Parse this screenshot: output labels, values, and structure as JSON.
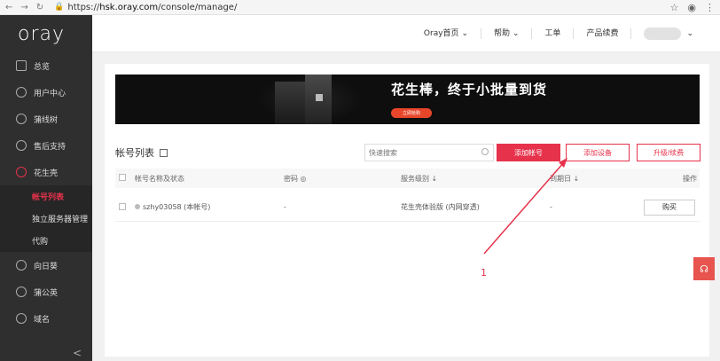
{
  "browser": {
    "url_prefix": "https://",
    "url_host": "hsk.oray.com",
    "url_path": "/console/manage/"
  },
  "sidebar": {
    "logo": "oray",
    "items": [
      {
        "label": "总览"
      },
      {
        "label": "用户中心"
      },
      {
        "label": "蒲线树"
      },
      {
        "label": "售后支持"
      },
      {
        "label": "花生壳"
      }
    ],
    "submenu": [
      {
        "label": "帐号列表"
      },
      {
        "label": "独立服务器管理"
      },
      {
        "label": "代购"
      }
    ],
    "items_bottom": [
      {
        "label": "向日葵"
      },
      {
        "label": "蒲公英"
      },
      {
        "label": "域名"
      }
    ],
    "collapse": "<"
  },
  "topbar": {
    "home": "Oray首页",
    "help": "帮助",
    "ticket": "工单",
    "renew": "产品续费"
  },
  "banner": {
    "headline": "花生棒，终于小批量到货",
    "cta": "立即抢购"
  },
  "toolbar": {
    "section_title": "帐号列表",
    "search_placeholder": "快速搜索",
    "add_account": "添加帐号",
    "add_device": "添加设备",
    "upgrade": "升级/续费"
  },
  "table": {
    "headers": {
      "name": "帐号名称及状态",
      "password": "密码",
      "service": "服务级别 ↓",
      "expiry": "到期日 ↓",
      "action": "操作"
    },
    "rows": [
      {
        "name": "szhy03058 (本帐号)",
        "password": "-",
        "service": "花生壳体验版 (内网穿透)",
        "expiry": "-",
        "action": "购买"
      }
    ]
  },
  "annotation": {
    "label": "1",
    "color": "#e6324b"
  },
  "colors": {
    "accent": "#e6324b",
    "sidebar_bg": "#2f2f2f"
  }
}
